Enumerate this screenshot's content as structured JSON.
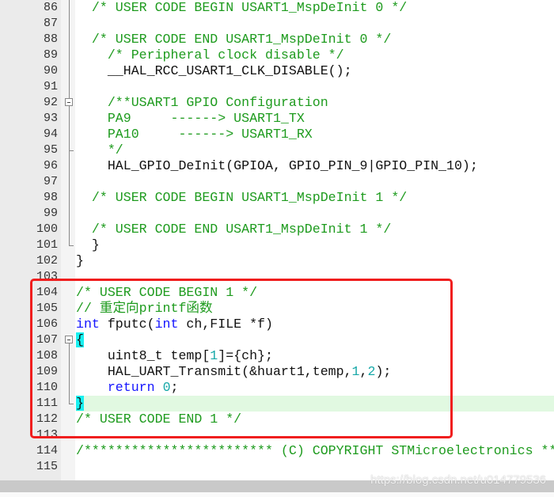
{
  "editor": {
    "lines": [
      {
        "n": "86",
        "fold": "line",
        "tokens": [
          {
            "t": "  "
          },
          {
            "t": "/* USER CODE BEGIN USART1_MspDeInit 0 */",
            "c": "cm"
          }
        ]
      },
      {
        "n": "87",
        "fold": "line",
        "tokens": []
      },
      {
        "n": "88",
        "fold": "line",
        "tokens": [
          {
            "t": "  "
          },
          {
            "t": "/* USER CODE END USART1_MspDeInit 0 */",
            "c": "cm"
          }
        ]
      },
      {
        "n": "89",
        "fold": "line",
        "tokens": [
          {
            "t": "    "
          },
          {
            "t": "/* Peripheral clock disable */",
            "c": "cm"
          }
        ]
      },
      {
        "n": "90",
        "fold": "line",
        "tokens": [
          {
            "t": "    __HAL_RCC_USART1_CLK_DISABLE();"
          }
        ]
      },
      {
        "n": "91",
        "fold": "line",
        "tokens": []
      },
      {
        "n": "92",
        "fold": "box",
        "tokens": [
          {
            "t": "    "
          },
          {
            "t": "/**USART1 GPIO Configuration",
            "c": "cm"
          }
        ]
      },
      {
        "n": "93",
        "fold": "line",
        "tokens": [
          {
            "t": "    "
          },
          {
            "t": "PA9     ------> USART1_TX",
            "c": "cm"
          }
        ]
      },
      {
        "n": "94",
        "fold": "line",
        "tokens": [
          {
            "t": "    "
          },
          {
            "t": "PA10     ------> USART1_RX",
            "c": "cm"
          }
        ]
      },
      {
        "n": "95",
        "fold": "tee",
        "tokens": [
          {
            "t": "    "
          },
          {
            "t": "*/",
            "c": "cm"
          }
        ]
      },
      {
        "n": "96",
        "fold": "line",
        "tokens": [
          {
            "t": "    HAL_GPIO_DeInit(GPIOA, GPIO_PIN_9|GPIO_PIN_10);"
          }
        ]
      },
      {
        "n": "97",
        "fold": "line",
        "tokens": []
      },
      {
        "n": "98",
        "fold": "line",
        "tokens": [
          {
            "t": "  "
          },
          {
            "t": "/* USER CODE BEGIN USART1_MspDeInit 1 */",
            "c": "cm"
          }
        ]
      },
      {
        "n": "99",
        "fold": "line",
        "tokens": []
      },
      {
        "n": "100",
        "fold": "line",
        "tokens": [
          {
            "t": "  "
          },
          {
            "t": "/* USER CODE END USART1_MspDeInit 1 */",
            "c": "cm"
          }
        ]
      },
      {
        "n": "101",
        "fold": "end",
        "tokens": [
          {
            "t": "  }"
          }
        ]
      },
      {
        "n": "102",
        "fold": "none",
        "tokens": [
          {
            "t": "}"
          }
        ]
      },
      {
        "n": "103",
        "fold": "none",
        "tokens": []
      },
      {
        "n": "104",
        "fold": "none",
        "tokens": [
          {
            "t": "/* USER CODE BEGIN 1 */",
            "c": "cm"
          }
        ]
      },
      {
        "n": "105",
        "fold": "none",
        "tokens": [
          {
            "t": "// 重定向printf函数",
            "c": "cm"
          }
        ]
      },
      {
        "n": "106",
        "fold": "none",
        "tokens": [
          {
            "t": "int",
            "c": "kw"
          },
          {
            "t": " fputc("
          },
          {
            "t": "int",
            "c": "kw"
          },
          {
            "t": " ch,FILE *f)"
          }
        ]
      },
      {
        "n": "107",
        "fold": "box",
        "tokens": [
          {
            "t": "{",
            "c": "br"
          }
        ]
      },
      {
        "n": "108",
        "fold": "line",
        "tokens": [
          {
            "t": "    uint8_t temp["
          },
          {
            "t": "1",
            "c": "num"
          },
          {
            "t": "]={ch};"
          }
        ]
      },
      {
        "n": "109",
        "fold": "line",
        "tokens": [
          {
            "t": "    HAL_UART_Transmit(&huart1,temp,"
          },
          {
            "t": "1",
            "c": "num"
          },
          {
            "t": ","
          },
          {
            "t": "2",
            "c": "num"
          },
          {
            "t": ");"
          }
        ]
      },
      {
        "n": "110",
        "fold": "line",
        "tokens": [
          {
            "t": "    "
          },
          {
            "t": "return",
            "c": "kw"
          },
          {
            "t": " "
          },
          {
            "t": "0",
            "c": "num"
          },
          {
            "t": ";"
          }
        ]
      },
      {
        "n": "111",
        "fold": "end",
        "highlight": true,
        "tokens": [
          {
            "t": "}",
            "c": "br"
          }
        ]
      },
      {
        "n": "112",
        "fold": "none",
        "tokens": [
          {
            "t": "/* USER CODE END 1 */",
            "c": "cm"
          }
        ]
      },
      {
        "n": "113",
        "fold": "none",
        "tokens": []
      },
      {
        "n": "114",
        "fold": "none",
        "tokens": [
          {
            "t": "/************************ (C) COPYRIGHT STMicroelectronics **",
            "c": "cm"
          }
        ]
      },
      {
        "n": "115",
        "fold": "none",
        "tokens": []
      }
    ],
    "colors": {
      "comment": "#1e9b1e",
      "keyword": "#1515ff",
      "number": "#17a8a8",
      "brace_match": "#19f0f0",
      "current_line": "#e1f9e1",
      "annotation_box": "#f01e1e"
    }
  },
  "watermark": "https://blog.csdn.net/u014779536"
}
